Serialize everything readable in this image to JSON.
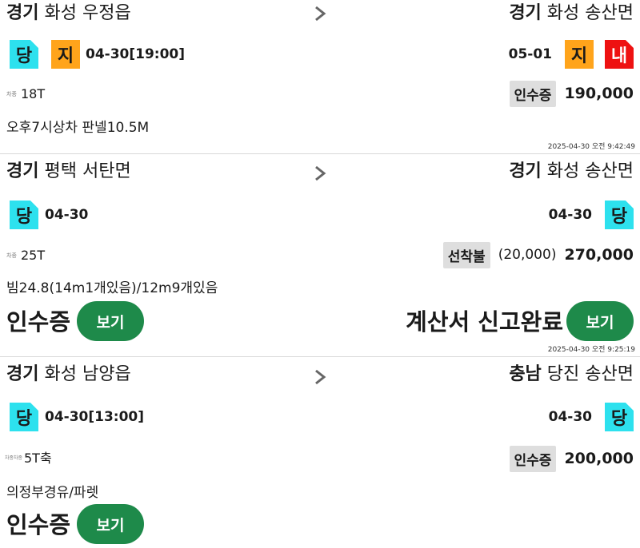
{
  "orders": [
    {
      "from": {
        "region": "경기",
        "place": "화성 우정읍"
      },
      "to": {
        "region": "경기",
        "place": "화성 송산면"
      },
      "load_badges": [
        "당",
        "지"
      ],
      "load_date": "04-30[19:00]",
      "unload_date": "05-01",
      "unload_badges": [
        "지",
        "내"
      ],
      "car_label": "차종",
      "tonnage": "18T",
      "payment": {
        "tag": "인수증",
        "extra": "",
        "fare": "190,000"
      },
      "memo": "오후7시상차 판넬10.5M",
      "timestamp": "2025-04-30 오전 9:42:49"
    },
    {
      "from": {
        "region": "경기",
        "place": "평택 서탄면"
      },
      "to": {
        "region": "경기",
        "place": "화성 송산면"
      },
      "load_badges": [
        "당"
      ],
      "load_date": "04-30",
      "unload_date": "04-30",
      "unload_badges": [
        "당"
      ],
      "car_label": "차종",
      "tonnage": "25T",
      "payment": {
        "tag": "선착불",
        "extra": "(20,000)",
        "fare": "270,000"
      },
      "memo": "빔24.8(14m1개있음)/12m9개있음",
      "left_label": "인수증",
      "right_label": "계산서 신고완료",
      "view_label": "보기",
      "timestamp": "2025-04-30 오전 9:25:19"
    },
    {
      "from": {
        "region": "경기",
        "place": "화성 남양읍"
      },
      "to": {
        "region": "충남",
        "place": "당진 송산면"
      },
      "load_badges": [
        "당"
      ],
      "load_date": "04-30[13:00]",
      "unload_date": "04-30",
      "unload_badges": [
        "당"
      ],
      "car_label": "차종차종",
      "tonnage": "5T축",
      "payment": {
        "tag": "인수증",
        "extra": "",
        "fare": "200,000"
      },
      "memo": "의정부경유/파렛",
      "left_label": "인수증",
      "view_label": "보기"
    }
  ],
  "colors": {
    "badge_cyan": "#2de1ee",
    "badge_orange": "#ffa41b",
    "badge_red": "#ee1111",
    "button_green": "#1e8a4a"
  }
}
